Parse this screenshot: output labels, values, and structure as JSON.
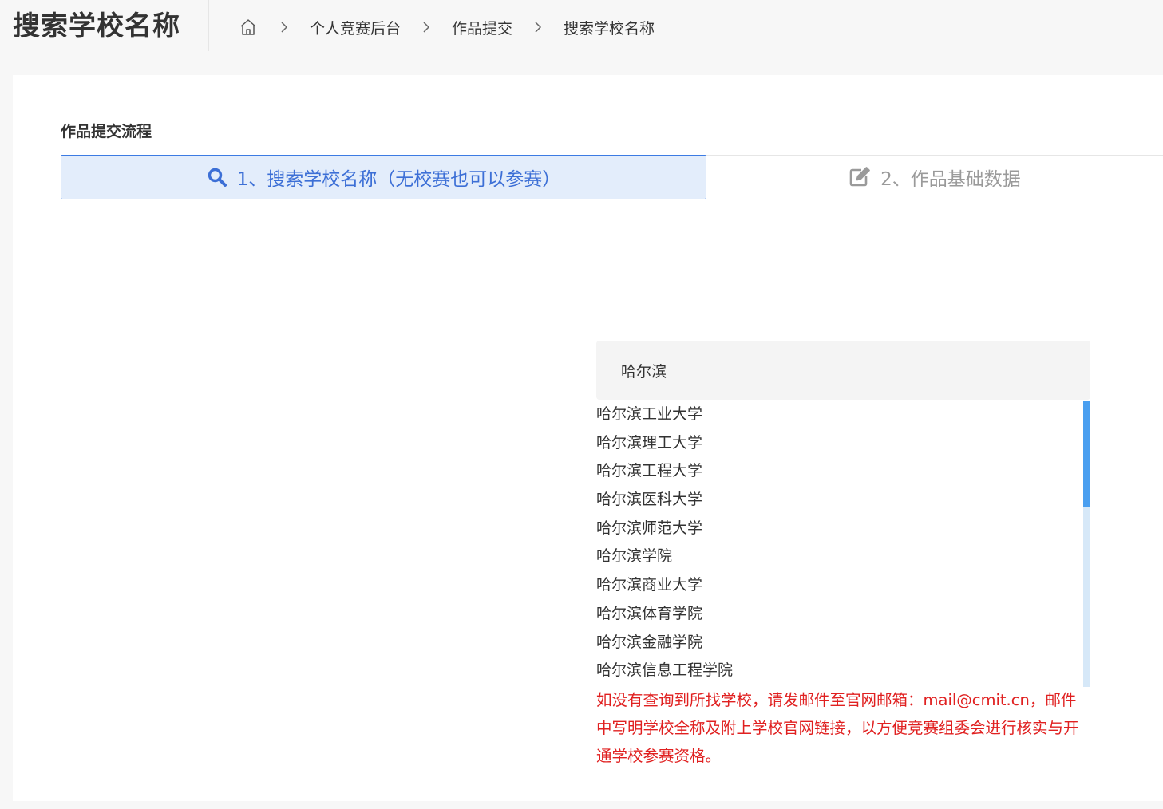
{
  "header": {
    "title": "搜索学校名称",
    "breadcrumb": [
      "个人竞赛后台",
      "作品提交",
      "搜索学校名称"
    ]
  },
  "section": {
    "label": "作品提交流程"
  },
  "steps": [
    {
      "label": "1、搜索学校名称（无校赛也可以参赛）",
      "icon": "search-icon",
      "active": true
    },
    {
      "label": "2、作品基础数据",
      "icon": "edit-icon",
      "active": false
    }
  ],
  "search": {
    "value": "哈尔滨"
  },
  "results": [
    "哈尔滨工业大学",
    "哈尔滨理工大学",
    "哈尔滨工程大学",
    "哈尔滨医科大学",
    "哈尔滨师范大学",
    "哈尔滨学院",
    "哈尔滨商业大学",
    "哈尔滨体育学院",
    "哈尔滨金融学院",
    "哈尔滨信息工程学院"
  ],
  "notice": "如没有查询到所找学校，请发邮件至官网邮箱：mail@cmit.cn，邮件中写明学校全称及附上学校官网链接，以方便竞赛组委会进行核实与开通学校参赛资格。",
  "colors": {
    "accent": "#3c7be3",
    "active_step_bg": "#e3edfb",
    "notice_text": "#e02020",
    "scrollbar_thumb": "#4a9ff0"
  }
}
